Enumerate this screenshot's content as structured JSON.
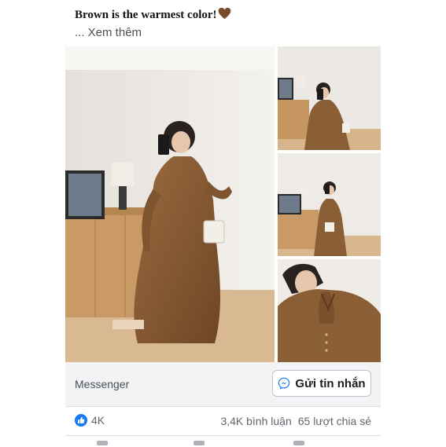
{
  "post": {
    "caption": "Brown is the warmest color!",
    "caption_emoji": "brown-heart-icon",
    "see_more": "... Xem thêm"
  },
  "gallery": {
    "photos": [
      "photo-main",
      "photo-thumb-1",
      "photo-thumb-2",
      "photo-thumb-3"
    ]
  },
  "cta": {
    "label": "Messenger",
    "button_label": "Gửi tin nhắn",
    "button_icon": "messenger-icon"
  },
  "stats": {
    "likes": "4K",
    "comments": "3,4K bình luận",
    "shares": "65 lượt chia sẻ"
  },
  "colors": {
    "accent": "#1877f2",
    "dress_brown": "#8a5f36",
    "bar_bg": "#f2f3f5"
  }
}
